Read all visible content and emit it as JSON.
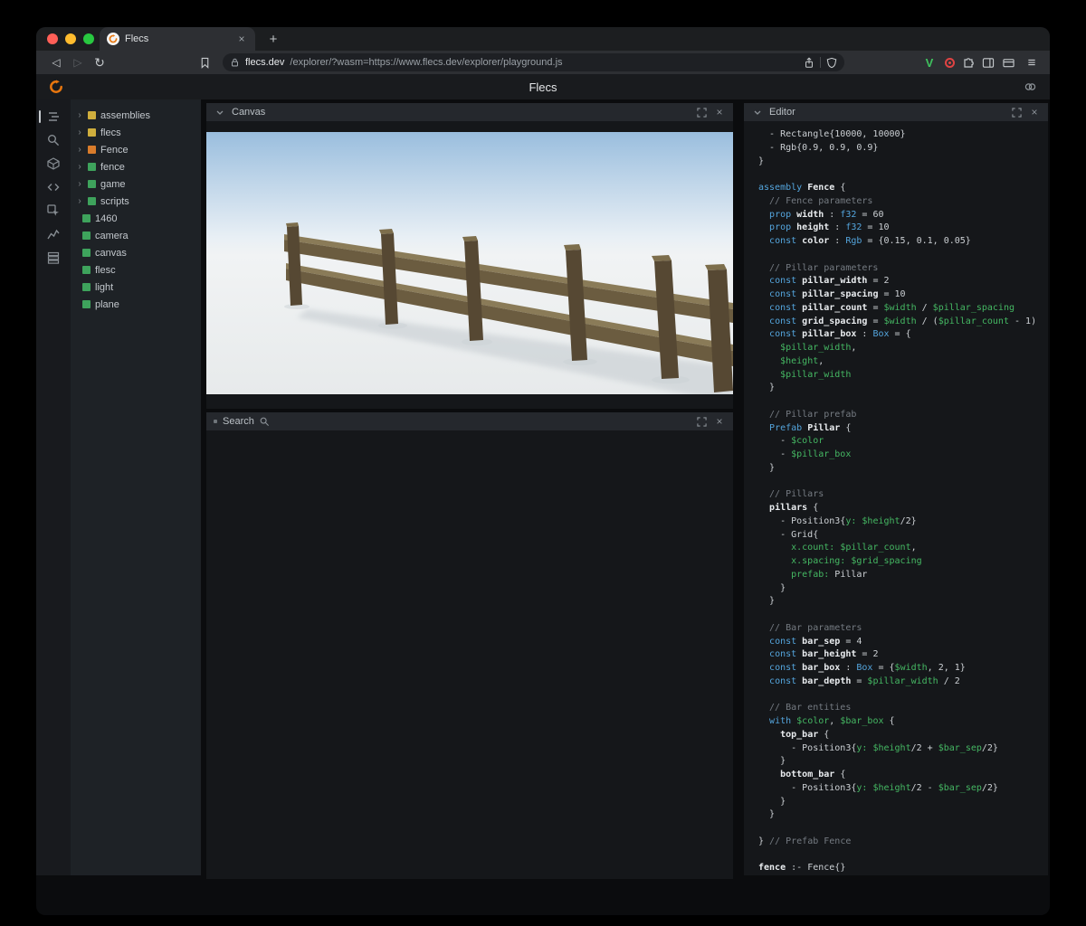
{
  "browser": {
    "tab_title": "Flecs",
    "tab_close": "×",
    "new_tab_label": "+",
    "back_glyph": "◁",
    "forward_glyph": "▷",
    "reload_glyph": "↻",
    "menu_glyph": "≡",
    "extension_v": "V",
    "url_domain": "flecs.dev",
    "url_path": "/explorer/?wasm=https://www.flecs.dev/explorer/playground.js"
  },
  "app": {
    "title": "Flecs"
  },
  "sidebar_icons": [
    "tree",
    "search",
    "entities",
    "code",
    "inspect",
    "stats",
    "tables"
  ],
  "panels": {
    "canvas_title": "Canvas",
    "search_title": "Search",
    "editor_title": "Editor",
    "close_glyph": "×"
  },
  "tree": {
    "expand_glyph": "›",
    "items": [
      {
        "label": "assemblies",
        "color": "#cfae3d",
        "expandable": true
      },
      {
        "label": "flecs",
        "color": "#cfae3d",
        "expandable": true
      },
      {
        "label": "Fence",
        "color": "#d97c2b",
        "expandable": true
      },
      {
        "label": "fence",
        "color": "#3ea35c",
        "expandable": true
      },
      {
        "label": "game",
        "color": "#3ea35c",
        "expandable": true
      },
      {
        "label": "scripts",
        "color": "#3ea35c",
        "expandable": true
      },
      {
        "label": "1460",
        "color": "#3ea35c",
        "expandable": false
      },
      {
        "label": "camera",
        "color": "#3ea35c",
        "expandable": false
      },
      {
        "label": "canvas",
        "color": "#3ea35c",
        "expandable": false
      },
      {
        "label": "flesc",
        "color": "#3ea35c",
        "expandable": false
      },
      {
        "label": "light",
        "color": "#3ea35c",
        "expandable": false
      },
      {
        "label": "plane",
        "color": "#3ea35c",
        "expandable": false
      }
    ]
  },
  "scene": {
    "sky_top": "#9abede",
    "sky_horizon": "#e8eff5",
    "ground": "#f1f3f4",
    "ground_low": "#e7eaeb",
    "shadow": "#ccd2d6",
    "rail_front": "#6b5c40",
    "rail_top": "#8a7b58",
    "pillar": "#564833",
    "pillar_cap": "#7d6e4c"
  },
  "editor_code": {
    "lines": [
      [
        [
          "p",
          "  - Rectangle{10000, 10000}"
        ]
      ],
      [
        [
          "p",
          "  - Rgb{0.9, 0.9, 0.9}"
        ]
      ],
      [
        [
          "p",
          "}"
        ]
      ],
      [],
      [
        [
          "k",
          "assembly "
        ],
        [
          "e",
          "Fence"
        ],
        [
          "p",
          " {"
        ]
      ],
      [
        [
          "c",
          "  // Fence parameters"
        ]
      ],
      [
        [
          "p",
          "  "
        ],
        [
          "k",
          "prop "
        ],
        [
          "e",
          "width"
        ],
        [
          "p",
          " : "
        ],
        [
          "k",
          "f32"
        ],
        [
          "p",
          " = 60"
        ]
      ],
      [
        [
          "p",
          "  "
        ],
        [
          "k",
          "prop "
        ],
        [
          "e",
          "height"
        ],
        [
          "p",
          " : "
        ],
        [
          "k",
          "f32"
        ],
        [
          "p",
          " = 10"
        ]
      ],
      [
        [
          "p",
          "  "
        ],
        [
          "k",
          "const "
        ],
        [
          "e",
          "color"
        ],
        [
          "p",
          " : "
        ],
        [
          "k",
          "Rgb"
        ],
        [
          "p",
          " = {0.15, 0.1, 0.05}"
        ]
      ],
      [],
      [
        [
          "c",
          "  // Pillar parameters"
        ]
      ],
      [
        [
          "p",
          "  "
        ],
        [
          "k",
          "const "
        ],
        [
          "e",
          "pillar_width"
        ],
        [
          "p",
          " = 2"
        ]
      ],
      [
        [
          "p",
          "  "
        ],
        [
          "k",
          "const "
        ],
        [
          "e",
          "pillar_spacing"
        ],
        [
          "p",
          " = 10"
        ]
      ],
      [
        [
          "p",
          "  "
        ],
        [
          "k",
          "const "
        ],
        [
          "e",
          "pillar_count"
        ],
        [
          "p",
          " = "
        ],
        [
          "v",
          "$width"
        ],
        [
          "p",
          " / "
        ],
        [
          "v",
          "$pillar_spacing"
        ]
      ],
      [
        [
          "p",
          "  "
        ],
        [
          "k",
          "const "
        ],
        [
          "e",
          "grid_spacing"
        ],
        [
          "p",
          " = "
        ],
        [
          "v",
          "$width"
        ],
        [
          "p",
          " / ("
        ],
        [
          "v",
          "$pillar_count"
        ],
        [
          "p",
          " - 1)"
        ]
      ],
      [
        [
          "p",
          "  "
        ],
        [
          "k",
          "const "
        ],
        [
          "e",
          "pillar_box"
        ],
        [
          "p",
          " : "
        ],
        [
          "k",
          "Box"
        ],
        [
          "p",
          " = {"
        ]
      ],
      [
        [
          "p",
          "    "
        ],
        [
          "v",
          "$pillar_width"
        ],
        [
          "p",
          ","
        ]
      ],
      [
        [
          "p",
          "    "
        ],
        [
          "v",
          "$height"
        ],
        [
          "p",
          ","
        ]
      ],
      [
        [
          "p",
          "    "
        ],
        [
          "v",
          "$pillar_width"
        ]
      ],
      [
        [
          "p",
          "  }"
        ]
      ],
      [],
      [
        [
          "c",
          "  // Pillar prefab"
        ]
      ],
      [
        [
          "p",
          "  "
        ],
        [
          "k",
          "Prefab "
        ],
        [
          "e",
          "Pillar"
        ],
        [
          "p",
          " {"
        ]
      ],
      [
        [
          "p",
          "    - "
        ],
        [
          "v",
          "$color"
        ]
      ],
      [
        [
          "p",
          "    - "
        ],
        [
          "v",
          "$pillar_box"
        ]
      ],
      [
        [
          "p",
          "  }"
        ]
      ],
      [],
      [
        [
          "c",
          "  // Pillars"
        ]
      ],
      [
        [
          "p",
          "  "
        ],
        [
          "e",
          "pillars"
        ],
        [
          "p",
          " {"
        ]
      ],
      [
        [
          "p",
          "    - Position3{"
        ],
        [
          "v",
          "y:"
        ],
        [
          "p",
          " "
        ],
        [
          "v",
          "$height"
        ],
        [
          "p",
          "/2}"
        ]
      ],
      [
        [
          "p",
          "    - Grid{"
        ]
      ],
      [
        [
          "p",
          "      "
        ],
        [
          "v",
          "x.count:"
        ],
        [
          "p",
          " "
        ],
        [
          "v",
          "$pillar_count"
        ],
        [
          "p",
          ","
        ]
      ],
      [
        [
          "p",
          "      "
        ],
        [
          "v",
          "x.spacing:"
        ],
        [
          "p",
          " "
        ],
        [
          "v",
          "$grid_spacing"
        ]
      ],
      [
        [
          "p",
          "      "
        ],
        [
          "v",
          "prefab:"
        ],
        [
          "p",
          " Pillar"
        ]
      ],
      [
        [
          "p",
          "    }"
        ]
      ],
      [
        [
          "p",
          "  }"
        ]
      ],
      [],
      [
        [
          "c",
          "  // Bar parameters"
        ]
      ],
      [
        [
          "p",
          "  "
        ],
        [
          "k",
          "const "
        ],
        [
          "e",
          "bar_sep"
        ],
        [
          "p",
          " = 4"
        ]
      ],
      [
        [
          "p",
          "  "
        ],
        [
          "k",
          "const "
        ],
        [
          "e",
          "bar_height"
        ],
        [
          "p",
          " = 2"
        ]
      ],
      [
        [
          "p",
          "  "
        ],
        [
          "k",
          "const "
        ],
        [
          "e",
          "bar_box"
        ],
        [
          "p",
          " : "
        ],
        [
          "k",
          "Box"
        ],
        [
          "p",
          " = {"
        ],
        [
          "v",
          "$width"
        ],
        [
          "p",
          ", 2, 1}"
        ]
      ],
      [
        [
          "p",
          "  "
        ],
        [
          "k",
          "const "
        ],
        [
          "e",
          "bar_depth"
        ],
        [
          "p",
          " = "
        ],
        [
          "v",
          "$pillar_width"
        ],
        [
          "p",
          " / 2"
        ]
      ],
      [],
      [
        [
          "c",
          "  // Bar entities"
        ]
      ],
      [
        [
          "p",
          "  "
        ],
        [
          "k",
          "with "
        ],
        [
          "v",
          "$color"
        ],
        [
          "p",
          ", "
        ],
        [
          "v",
          "$bar_box"
        ],
        [
          "p",
          " {"
        ]
      ],
      [
        [
          "p",
          "    "
        ],
        [
          "e",
          "top_bar"
        ],
        [
          "p",
          " {"
        ]
      ],
      [
        [
          "p",
          "      - Position3{"
        ],
        [
          "v",
          "y:"
        ],
        [
          "p",
          " "
        ],
        [
          "v",
          "$height"
        ],
        [
          "p",
          "/2 + "
        ],
        [
          "v",
          "$bar_sep"
        ],
        [
          "p",
          "/2}"
        ]
      ],
      [
        [
          "p",
          "    }"
        ]
      ],
      [
        [
          "p",
          "    "
        ],
        [
          "e",
          "bottom_bar"
        ],
        [
          "p",
          " {"
        ]
      ],
      [
        [
          "p",
          "      - Position3{"
        ],
        [
          "v",
          "y:"
        ],
        [
          "p",
          " "
        ],
        [
          "v",
          "$height"
        ],
        [
          "p",
          "/2 - "
        ],
        [
          "v",
          "$bar_sep"
        ],
        [
          "p",
          "/2}"
        ]
      ],
      [
        [
          "p",
          "    }"
        ]
      ],
      [
        [
          "p",
          "  }"
        ]
      ],
      [],
      [
        [
          "p",
          "} "
        ],
        [
          "c",
          "// Prefab Fence"
        ]
      ],
      [],
      [
        [
          "e",
          "fence"
        ],
        [
          "p",
          " :- Fence{}"
        ]
      ]
    ]
  }
}
